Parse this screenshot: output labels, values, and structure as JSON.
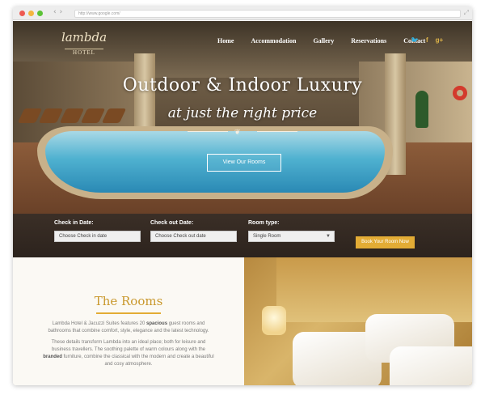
{
  "browser": {
    "url": "http://www.google.com/"
  },
  "nav": {
    "logo_script": "lambda",
    "logo_sub": "HOTEL",
    "menu": [
      "Home",
      "Accommodation",
      "Gallery",
      "Reservations",
      "Contact"
    ],
    "social": [
      {
        "icon": "twitter-icon",
        "glyph": "🐦"
      },
      {
        "icon": "facebook-icon",
        "glyph": "f"
      },
      {
        "icon": "google-plus-icon",
        "glyph": "g+"
      }
    ]
  },
  "hero": {
    "headline": "Outdoor & Indoor Luxury",
    "subheadline": "at just the right price",
    "cta": "View Our Rooms"
  },
  "booking": {
    "check_in_label": "Check in Date:",
    "check_in_value": "Choose Check in date",
    "check_out_label": "Check out Date:",
    "check_out_value": "Choose Check out date",
    "room_type_label": "Room type:",
    "room_type_value": "Single Room",
    "submit": "Book Your Room Now"
  },
  "rooms": {
    "title": "The Rooms",
    "para1_a": "Lambda Hotel & Jacuzzi Suites features 20 ",
    "para1_b": "spacious",
    "para1_c": " guest rooms and bathrooms that combine comfort, style, elegance and the latest technology.",
    "para2_a": "These details transform Lambda into an ideal place; both for leisure and business travellers. The soothing palette of warm colours along with the ",
    "para2_b": "branded",
    "para2_c": " furniture, combine the classical with the modern and create a beautiful and cosy atmosphere."
  },
  "colors": {
    "accent": "#e3ac35",
    "title_gold": "#c9982c",
    "booking_bg": "#2f2620"
  }
}
